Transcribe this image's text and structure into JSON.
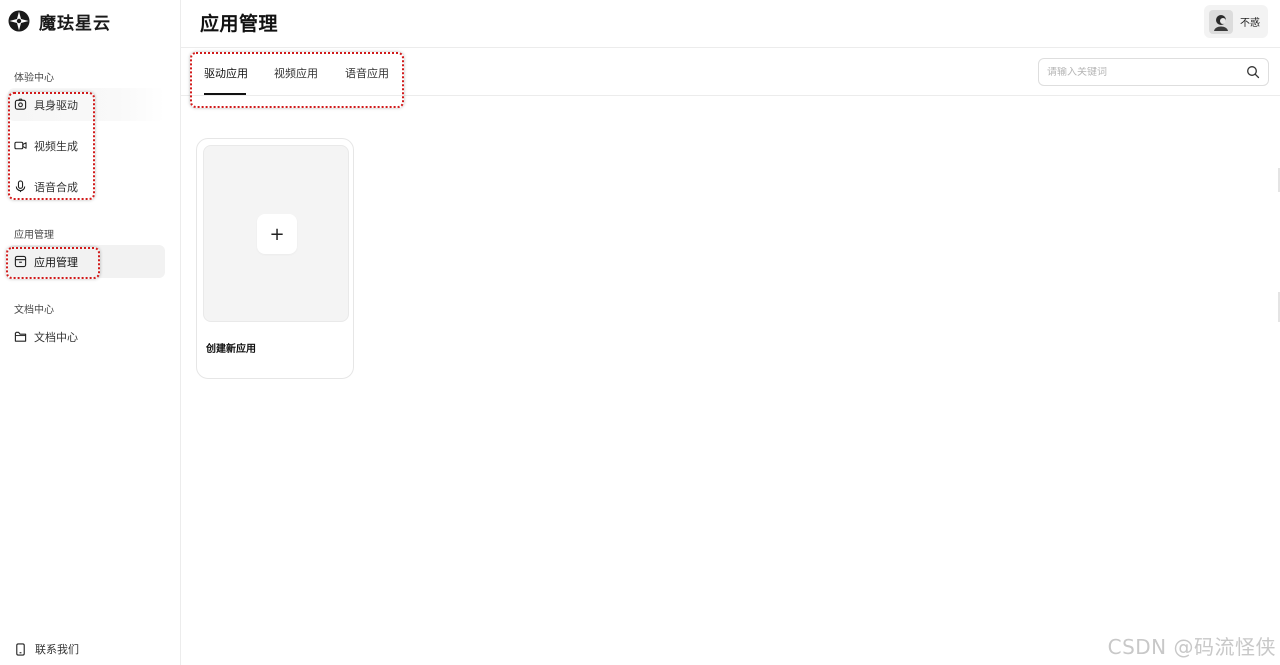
{
  "brand": {
    "name": "魔珐星云",
    "logo_icon": "brand-logo-icon"
  },
  "sidebar": {
    "sections": [
      {
        "label": "体验中心",
        "items": [
          {
            "label": "具身驱动",
            "icon": "camera-box-icon"
          },
          {
            "label": "视频生成",
            "icon": "video-camera-icon"
          },
          {
            "label": "语音合成",
            "icon": "microphone-icon"
          }
        ]
      },
      {
        "label": "应用管理",
        "items": [
          {
            "label": "应用管理",
            "icon": "app-box-icon",
            "active": true
          }
        ]
      },
      {
        "label": "文档中心",
        "items": [
          {
            "label": "文档中心",
            "icon": "folder-icon"
          }
        ]
      }
    ],
    "contact": {
      "label": "联系我们",
      "icon": "phone-icon"
    }
  },
  "header": {
    "title": "应用管理",
    "user": {
      "name": "不惑",
      "avatar_icon": "avatar-icon"
    }
  },
  "tabs": [
    {
      "label": "驱动应用",
      "active": true
    },
    {
      "label": "视频应用"
    },
    {
      "label": "语音应用"
    }
  ],
  "search": {
    "placeholder": "请输入关键词",
    "value": ""
  },
  "cards": [
    {
      "title": "创建新应用",
      "action_symbol": "+"
    }
  ],
  "watermark": "CSDN @码流怪侠",
  "colors": {
    "highlight": "#d11a1a",
    "accent": "#111111",
    "active_bg": "#f2f2f2"
  }
}
